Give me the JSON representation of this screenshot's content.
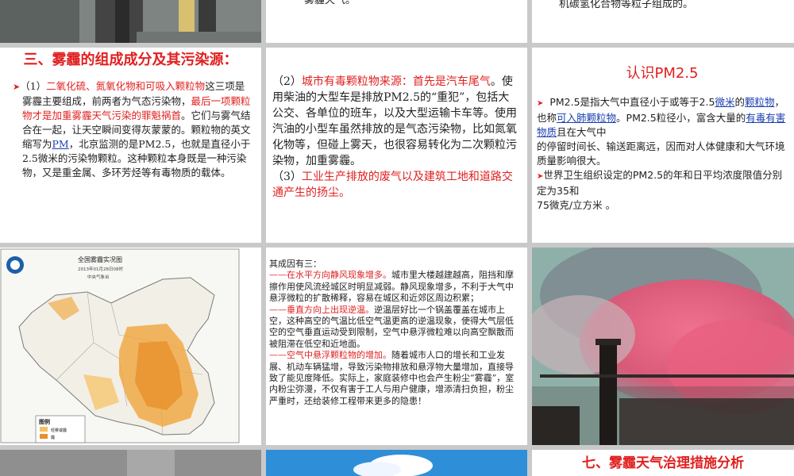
{
  "slide1": {
    "desc": "photo"
  },
  "slide2": {
    "text": "雾霾天气。"
  },
  "slide3": {
    "text": "机碳氢化合物等粒子组成的。"
  },
  "slide4": {
    "title": "三、雾霾的组成成分及其污染源：",
    "p1_a": "（1）",
    "p1_b": "二氧化硫、氮氧化物和可吸入颗粒物",
    "p1_c": "这三项是雾霾主要组成，前两者为气态污染物，",
    "p1_d": "最后一项颗粒物才是加重雾霾天气污染的罪魁祸首",
    "p1_e": "。它们与雾气结合在一起，让天空瞬间变得灰蒙蒙的。颗粒物的英文缩写为",
    "p1_f": "PM",
    "p1_g": "，北京监测的是PM2.5，也就是直径小于2.5微米的污染物颗粒。这种颗粒本身既是一种污染物，又是重金属、多环芳烃等有毒物质的载体。"
  },
  "slide5": {
    "p1_a": "（2）",
    "p1_b": "城市有毒颗粒物来源：首先是汽车尾气",
    "p1_c": "。使用柴油的大型车是排放PM2.5的“重犯”，包括大公交、各单位的班车，以及大型运输卡车等。使用汽油的小型车虽然排放的是气态污染物，比如氮氧化物等，但碰上雾天，也很容易转化为二次颗粒污染物，加重雾霾。",
    "p2_a": "（3）",
    "p2_b": "工业生产排放的废气以及建筑工地和道路交通产生的扬尘。"
  },
  "slide6": {
    "title": "认识PM2.5",
    "p1_a": "PM2.5是指大气中直径小于或等于2.5",
    "p1_b": "微米",
    "p1_c": "的",
    "p1_d": "颗粒物",
    "p1_e": "，也称",
    "p1_f": "可入肺颗粒物",
    "p1_g": "。PM2.5粒径小，富含大量的",
    "p1_h": "有毒有害物质",
    "p1_i": "且在大气中",
    "p1_j": "的停留时间长、输送距离远，因而对人体健康和大气环境质量影响很大。",
    "p2_a": "世界卫生组织设定的PM2.5的年和日平均浓度限值分别定为35和",
    "p2_b": "75微克/立方米 。"
  },
  "slide7": {
    "map_title": "全国雾霾实况图",
    "map_date": "2013年01月28日08时",
    "map_source": "中央气象台",
    "legend_title": "图例",
    "legend1": "轻雾或霾",
    "legend2": "霾"
  },
  "slide8": {
    "intro": "其成因有三：",
    "c1_a": "——在水平方向静风现象增多。",
    "c1_b": "城市里大楼越建越高，阻挡和摩擦作用使风流经城区时明显减弱。静风现象增多，不利于大气中悬浮微粒的扩散稀释，容易在城区和近郊区周边积累；",
    "c2_a": "——垂直方向上出现逆温。",
    "c2_b": "逆温层好比一个锅盖覆盖在城市上空，这种高空的气温比低空气温更高的逆温现象，使得大气层低空的空气垂直运动受到限制，空气中悬浮微粒难以向高空飘散而被阻滞在低空和近地面。",
    "c3_a": "——空气中悬浮颗粒物的增加。",
    "c3_b": "随着城市人口的增长和工业发展、机动车辆猛增，导致污染物排放和悬浮物大量增加，直接导致了能见度降低。实际上，家庭装修中也会产生粉尘“雾霾”，室内粉尘弥漫，不仅有害于工人与用户健康，增添清扫负担，粉尘严重时，还给装修工程带来更多的隐患！"
  },
  "slide12": {
    "title": "七、雾霾天气治理措施分析"
  },
  "colors": {
    "accent_red": "#e02020",
    "link_blue": "#1a3fb0",
    "map_orange": "#f0a030"
  }
}
